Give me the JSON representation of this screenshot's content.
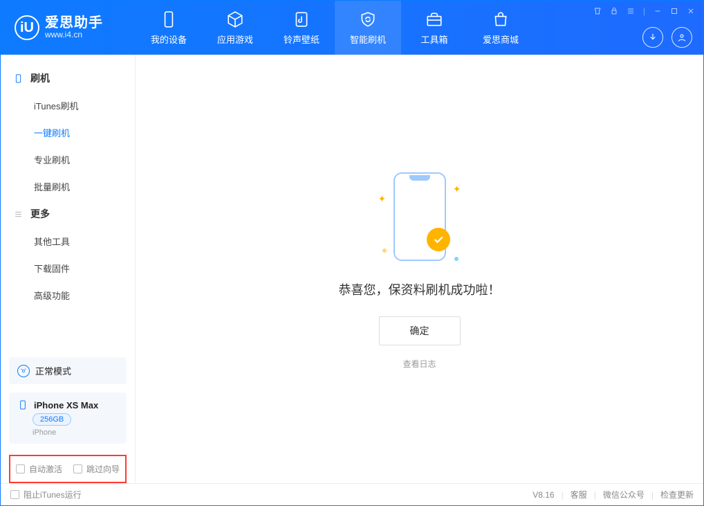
{
  "logo": {
    "title": "爱思助手",
    "sub": "www.i4.cn",
    "mark": "iU"
  },
  "tabs": {
    "device": "我的设备",
    "apps": "应用游戏",
    "ring": "铃声壁纸",
    "flash": "智能刷机",
    "toolbox": "工具箱",
    "store": "爱思商城"
  },
  "sidebar": {
    "section1": "刷机",
    "items1": [
      "iTunes刷机",
      "一键刷机",
      "专业刷机",
      "批量刷机"
    ],
    "section2": "更多",
    "items2": [
      "其他工具",
      "下载固件",
      "高级功能"
    ]
  },
  "mode": {
    "label": "正常模式"
  },
  "device": {
    "name": "iPhone XS Max",
    "storage": "256GB",
    "type": "iPhone"
  },
  "checks": {
    "autoActivate": "自动激活",
    "skipGuide": "跳过向导"
  },
  "main": {
    "success": "恭喜您，保资料刷机成功啦！",
    "ok": "确定",
    "viewLog": "查看日志"
  },
  "footer": {
    "blockItunes": "阻止iTunes运行",
    "version": "V8.16",
    "support": "客服",
    "wechat": "微信公众号",
    "update": "检查更新"
  }
}
